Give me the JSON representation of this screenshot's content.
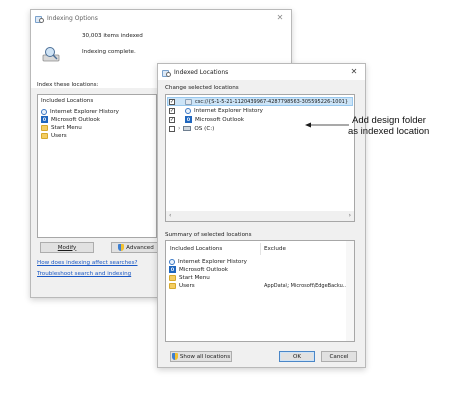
{
  "indexing_options": {
    "title": "Indexing Options",
    "items_indexed": "30,003 items indexed",
    "status": "Indexing complete.",
    "index_these_locations": "Index these locations:",
    "included_locations_header": "Included Locations",
    "locations": [
      "Internet Explorer History",
      "Microsoft Outlook",
      "Start Menu",
      "Users"
    ],
    "modify_button": "Modify",
    "advanced_button": "Advanced",
    "link_how": "How does indexing affect searches?",
    "link_troubleshoot": "Troubleshoot search and indexing"
  },
  "indexed_locations": {
    "title": "Indexed Locations",
    "change_selected": "Change selected locations",
    "tree": [
      {
        "label": "csc://{S-1-5-21-1120439967-4287798563-305595226-1001}",
        "checked": true,
        "selected": true
      },
      {
        "label": "Internet Explorer History",
        "checked": true,
        "selected": false
      },
      {
        "label": "Microsoft Outlook",
        "checked": true,
        "selected": false
      },
      {
        "label": "OS (C:)",
        "checked": false,
        "selected": false
      }
    ],
    "summary_label": "Summary of selected locations",
    "summary_headers": [
      "Included Locations",
      "Exclude"
    ],
    "summary_rows": [
      {
        "location": "Internet Explorer History",
        "exclude": ""
      },
      {
        "location": "Microsoft Outlook",
        "exclude": ""
      },
      {
        "location": "Start Menu",
        "exclude": ""
      },
      {
        "location": "Users",
        "exclude": "AppData\\; Microsoft\\EdgeBacku..."
      }
    ],
    "show_all_button": "Show all locations",
    "ok_button": "OK",
    "cancel_button": "Cancel"
  },
  "annotation": {
    "line1": "Add design folder",
    "line2": "as indexed location"
  }
}
